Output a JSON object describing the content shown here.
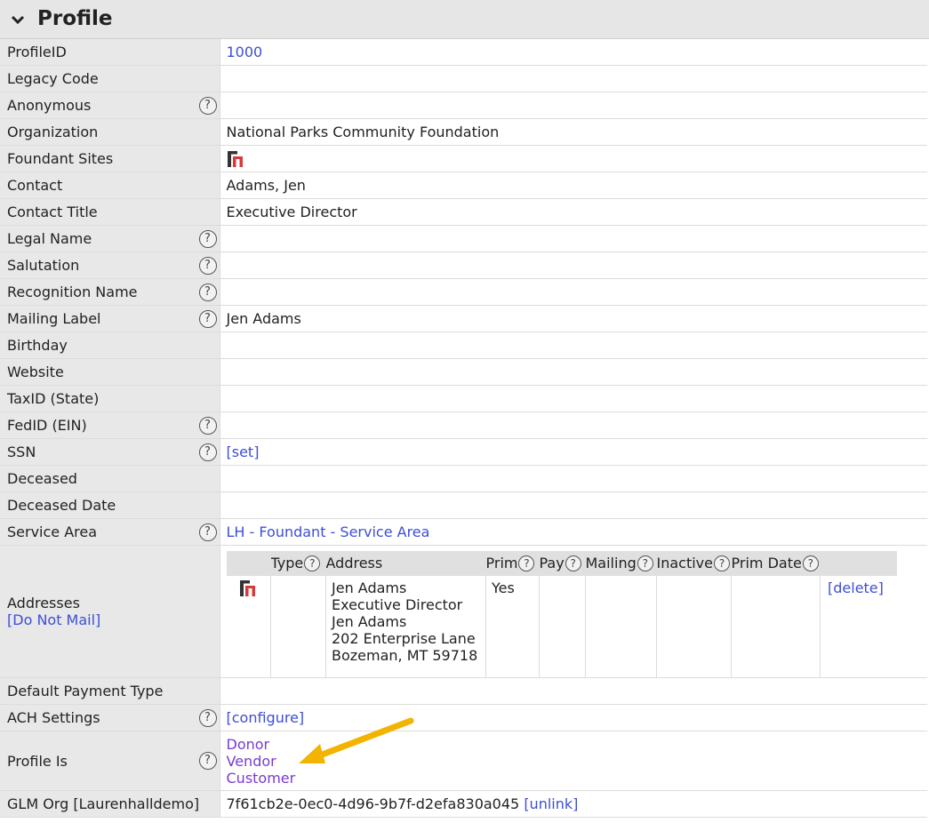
{
  "header": {
    "title": "Profile"
  },
  "rows": [
    {
      "label": "ProfileID",
      "value": "1000",
      "link": true,
      "help": false
    },
    {
      "label": "Legacy Code",
      "value": "",
      "help": false
    },
    {
      "label": "Anonymous",
      "value": "",
      "help": true
    },
    {
      "label": "Organization",
      "value": "National Parks Community Foundation",
      "help": false
    },
    {
      "label": "Foundant Sites",
      "value": "",
      "help": false,
      "icon": "foundant-logo-icon"
    },
    {
      "label": "Contact",
      "value": "Adams, Jen",
      "help": false
    },
    {
      "label": "Contact Title",
      "value": "Executive Director",
      "help": false
    },
    {
      "label": "Legal Name",
      "value": "",
      "help": true
    },
    {
      "label": "Salutation",
      "value": "",
      "help": true
    },
    {
      "label": "Recognition Name",
      "value": "",
      "help": true
    },
    {
      "label": "Mailing Label",
      "value": "Jen Adams",
      "help": true
    },
    {
      "label": "Birthday",
      "value": "",
      "help": false
    },
    {
      "label": "Website",
      "value": "",
      "help": false
    },
    {
      "label": "TaxID (State)",
      "value": "",
      "help": false
    },
    {
      "label": "FedID (EIN)",
      "value": "",
      "help": true
    },
    {
      "label": "SSN",
      "value": "[set]",
      "link": true,
      "help": true
    },
    {
      "label": "Deceased",
      "value": "",
      "help": false
    },
    {
      "label": "Deceased Date",
      "value": "",
      "help": false
    },
    {
      "label": "Service Area",
      "value": "LH - Foundant - Service Area",
      "link": true,
      "help": true
    }
  ],
  "addresses": {
    "label": "Addresses",
    "do_not_mail": "[Do Not Mail]",
    "columns": [
      "Type",
      "Address",
      "Prim",
      "Pay",
      "Mailing",
      "Inactive",
      "Prim Date"
    ],
    "row": {
      "address_lines": [
        "Jen Adams",
        "Executive Director",
        "Jen Adams",
        "202 Enterprise Lane",
        "Bozeman, MT 59718"
      ],
      "prim": "Yes",
      "delete": "[delete]"
    }
  },
  "rows2": [
    {
      "label": "Default Payment Type",
      "value": "",
      "help": false
    },
    {
      "label": "ACH Settings",
      "value": "[configure]",
      "link": true,
      "help": true
    }
  ],
  "profile_is": {
    "label": "Profile Is",
    "items": [
      "Donor",
      "Vendor",
      "Customer"
    ]
  },
  "glm": {
    "label": "GLM Org [Laurenhalldemo]",
    "value": "7f61cb2e-0ec0-4d96-9b7f-d2efa830a045",
    "unlink": "[unlink]"
  },
  "colors": {
    "link": "#3d4fd6",
    "visited": "#7a3bd0",
    "arrow": "#f2b400",
    "label_bg": "#e8e8e8"
  }
}
